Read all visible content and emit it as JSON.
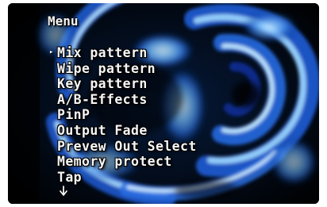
{
  "menu": {
    "title": "Menu",
    "cursor_glyph": "▸",
    "selected_index": 0,
    "items": [
      {
        "label": "Mix pattern"
      },
      {
        "label": "Wipe pattern"
      },
      {
        "label": "Key pattern"
      },
      {
        "label": "A/B-Effects"
      },
      {
        "label": "PinP"
      },
      {
        "label": "Output Fade"
      },
      {
        "label": "Prevew Out Select"
      },
      {
        "label": "Memory protect"
      },
      {
        "label": "Tap"
      }
    ],
    "more_icon": "down-arrow-icon"
  },
  "colors": {
    "text": "#f6f6f6",
    "background_dark": "#000814",
    "swirl_light": "#8fd2ff",
    "swirl_mid": "#2f7fe0",
    "swirl_deep": "#0a2f8a"
  }
}
